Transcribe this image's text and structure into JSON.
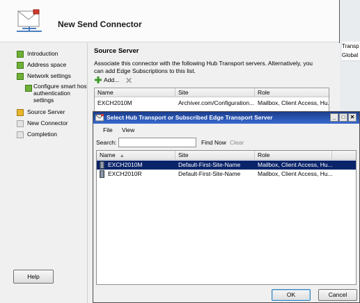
{
  "background_window": {
    "header_cell": "Transp",
    "row_cell": "Global"
  },
  "wizard": {
    "title": "New Send Connector",
    "icon": "envelope-connector-icon",
    "steps": [
      {
        "label": "Introduction",
        "status": "complete"
      },
      {
        "label": "Address space",
        "status": "complete"
      },
      {
        "label": "Network settings",
        "status": "complete"
      },
      {
        "label": "Configure smart host authentication settings",
        "status": "complete"
      },
      {
        "label": "Source Server",
        "status": "current"
      },
      {
        "label": "New Connector",
        "status": "pending"
      },
      {
        "label": "Completion",
        "status": "pending"
      }
    ],
    "help_label": "Help",
    "section_title": "Source Server",
    "section_description": "Associate this connector with the following Hub Transport servers. Alternatively, you can add Edge Subscriptions to this list.",
    "add_label": "Add...",
    "remove_icon": "remove-x-icon",
    "grid_columns": [
      "Name",
      "Site",
      "Role"
    ],
    "grid_rows": [
      {
        "name": "EXCH2010M",
        "site": "Archiver.com/Configuration...",
        "role": "Mailbox, Client Access, Hu..."
      }
    ]
  },
  "picker": {
    "title": "Select Hub Transport or Subscribed Edge Transport Server",
    "menu": [
      "File",
      "View"
    ],
    "search_label": "Search:",
    "search_value": "",
    "find_now_label": "Find Now",
    "clear_label": "Clear",
    "columns": [
      "Name",
      "Site",
      "Role"
    ],
    "rows": [
      {
        "name": "EXCH2010M",
        "site": "Default-First-Site-Name",
        "role": "Mailbox, Client Access, Hu...",
        "selected": true
      },
      {
        "name": "EXCH2010R",
        "site": "Default-First-Site-Name",
        "role": "Mailbox, Client Access, Hu...",
        "selected": false
      }
    ],
    "ok_label": "OK",
    "cancel_label": "Cancel",
    "window_buttons": [
      "minimize",
      "maximize",
      "close"
    ]
  },
  "colors": {
    "step_complete": "#6fb036",
    "step_current": "#e7b52c",
    "selection": "#0a246a",
    "titlebar": "#2b58b6"
  }
}
